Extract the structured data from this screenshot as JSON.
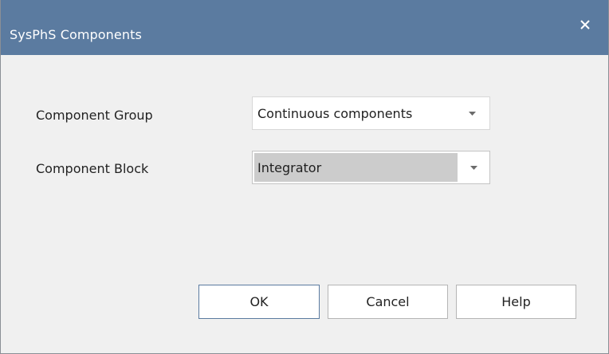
{
  "window": {
    "title": "SysPhS Components",
    "close_icon": "close-icon"
  },
  "form": {
    "group_label": "Component Group",
    "group_value": "Continuous components",
    "block_label": "Component Block",
    "block_value": "Integrator"
  },
  "buttons": {
    "ok": "OK",
    "cancel": "Cancel",
    "help": "Help"
  },
  "colors": {
    "titlebar": "#5b7ba0",
    "dialog_bg": "#f0f0f0",
    "selected_bg": "#cccccc"
  }
}
